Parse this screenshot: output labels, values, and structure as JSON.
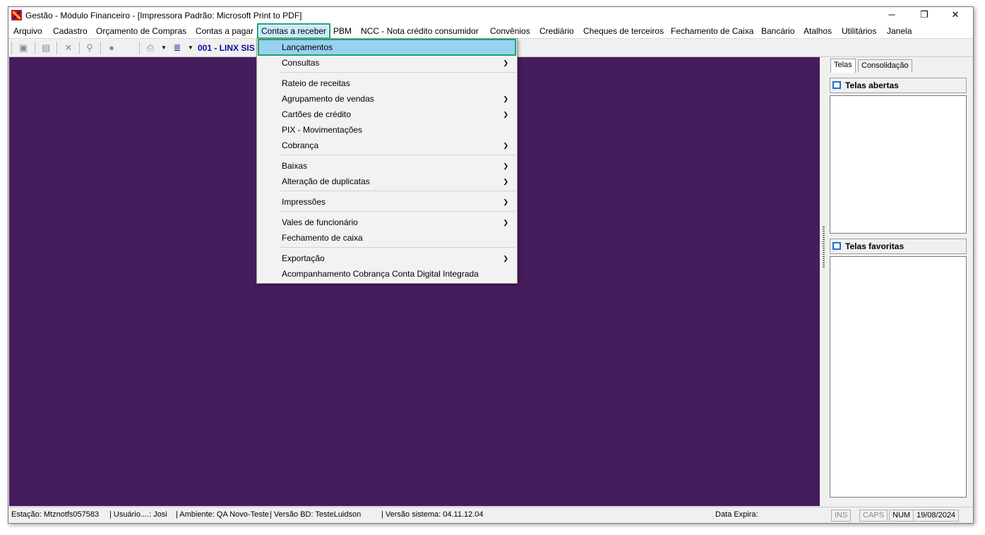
{
  "window": {
    "title": "Gestão  - Módulo Financeiro - [Impressora Padrão: Microsoft Print to PDF]",
    "minimize": "─",
    "restore": "❐",
    "close": "✕"
  },
  "menubar": [
    {
      "id": "arquivo",
      "label": "Arquivo"
    },
    {
      "id": "cadastro",
      "label": "Cadastro"
    },
    {
      "id": "orcamento",
      "label": "Orçamento de Compras"
    },
    {
      "id": "contas-pagar",
      "label": "Contas a pagar"
    },
    {
      "id": "contas-receber",
      "label": "Contas a receber",
      "active": true
    },
    {
      "id": "pbm",
      "label": "PBM"
    },
    {
      "id": "ncc",
      "label": "NCC - Nota crédito consumidor"
    },
    {
      "id": "convenios",
      "label": "Convênios"
    },
    {
      "id": "crediario",
      "label": "Crediário"
    },
    {
      "id": "cheques",
      "label": "Cheques de terceiros"
    },
    {
      "id": "fechamento",
      "label": "Fechamento de Caixa"
    },
    {
      "id": "bancario",
      "label": "Bancário"
    },
    {
      "id": "atalhos",
      "label": "Atalhos"
    },
    {
      "id": "utilitarios",
      "label": "Utilitários"
    },
    {
      "id": "janela",
      "label": "Janela"
    }
  ],
  "toolbar": {
    "company": "001 - LINX SIS"
  },
  "dropdown": [
    {
      "label": "Lançamentos",
      "submenu": false,
      "highlighted": true
    },
    {
      "label": "Consultas",
      "submenu": true
    },
    {
      "label": "Rateio de receitas",
      "submenu": false
    },
    {
      "label": "Agrupamento de vendas",
      "submenu": true
    },
    {
      "label": "Cartões de crédito",
      "submenu": true
    },
    {
      "label": "PIX - Movimentações",
      "submenu": false
    },
    {
      "label": "Cobrança",
      "submenu": true
    },
    {
      "label": "Baixas",
      "submenu": true
    },
    {
      "label": "Alteração de duplicatas",
      "submenu": true
    },
    {
      "label": "Impressões",
      "submenu": true
    },
    {
      "label": "Vales de funcionário",
      "submenu": true
    },
    {
      "label": "Fechamento de caixa",
      "submenu": false
    },
    {
      "label": "Exportação",
      "submenu": true
    },
    {
      "label": "Acompanhamento Cobrança Conta Digital Integrada",
      "submenu": false
    }
  ],
  "right_panel": {
    "tabs": [
      "Telas",
      "Consolidação"
    ],
    "open_header": "Telas abertas",
    "fav_header": "Telas favoritas"
  },
  "status": {
    "estacao": "Estação: Mtznotfs057583",
    "usuario": "| Usuário....: Josi",
    "ambiente": "| Ambiente: QA Novo-Teste",
    "versao_bd": "| Versão BD: TesteLuidson",
    "versao_sistema": "| Versão sistema: 04.11.12.04",
    "data_expira": "Data Expira:",
    "ins": "INS",
    "caps": "CAPS",
    "num": "NUM",
    "date": "19/08/2024"
  },
  "colors": {
    "mdi_background": "#451c5c",
    "highlight_outline": "#17a673",
    "menu_highlight": "#99d1f0"
  }
}
